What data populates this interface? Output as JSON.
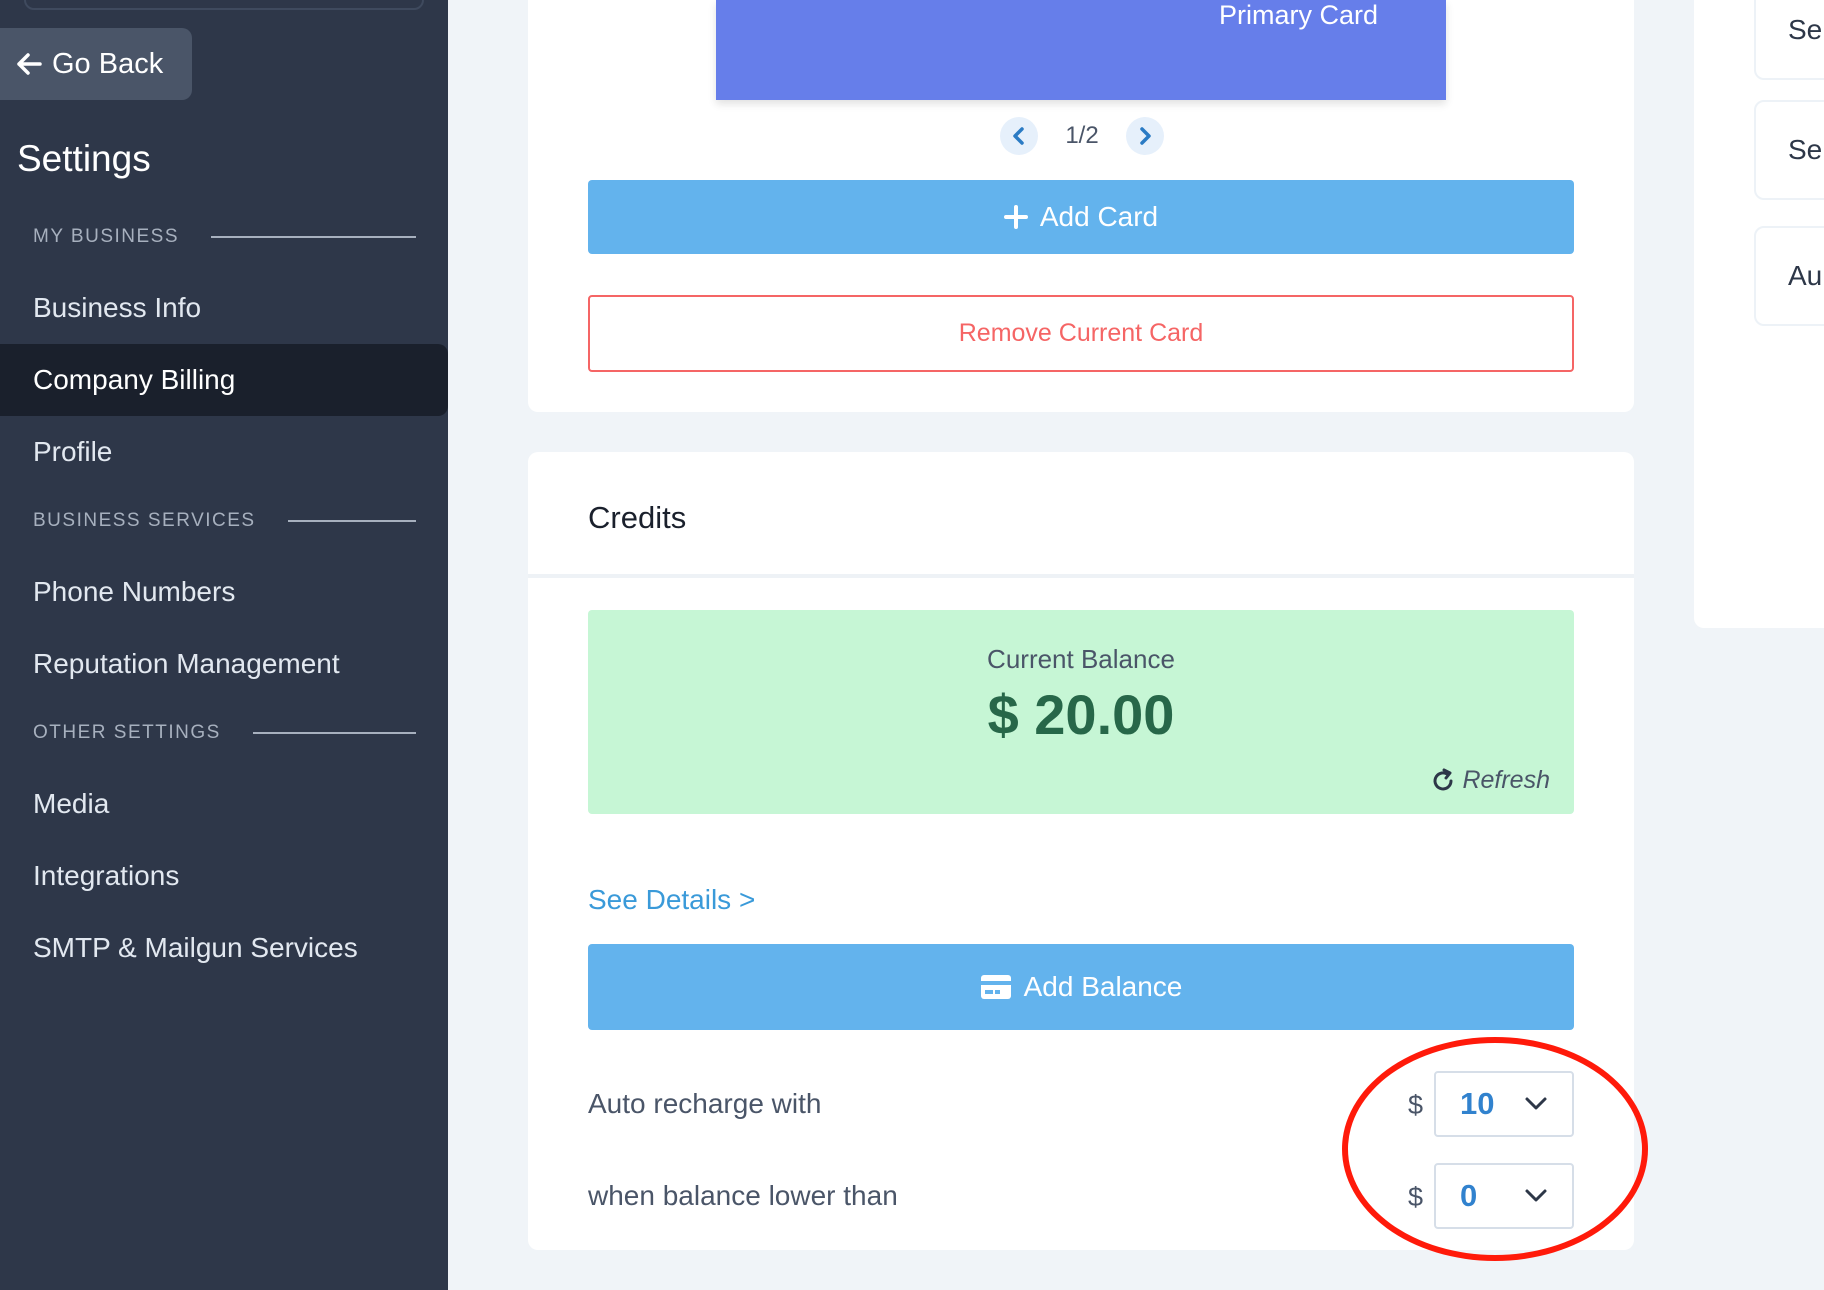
{
  "sidebar": {
    "go_back": "Go Back",
    "title": "Settings",
    "sections": {
      "my_business": "MY BUSINESS",
      "business_services": "BUSINESS SERVICES",
      "other_settings": "OTHER SETTINGS"
    },
    "items": {
      "business_info": "Business Info",
      "company_billing": "Company Billing",
      "profile": "Profile",
      "phone_numbers": "Phone Numbers",
      "reputation_management": "Reputation Management",
      "media": "Media",
      "integrations": "Integrations",
      "smtp": "SMTP & Mailgun Services"
    },
    "active_item": "Company Billing"
  },
  "card_section": {
    "primary_card_label": "Primary Card",
    "pager_text": "1/2",
    "add_card_label": "Add Card",
    "remove_card_label": "Remove Current Card"
  },
  "credits": {
    "title": "Credits",
    "balance_label": "Current Balance",
    "balance_amount": "$ 20.00",
    "refresh_label": "Refresh",
    "see_details": "See Details >",
    "add_balance_label": "Add Balance",
    "auto_recharge_label": "Auto recharge with",
    "threshold_label": "when balance lower than",
    "currency_symbol": "$",
    "auto_recharge_value": "10",
    "threshold_value": "0"
  },
  "right_column": {
    "items": [
      "Sep",
      "Sep",
      "Au"
    ]
  },
  "colors": {
    "sidebar_bg": "#2e3749",
    "active_item_bg": "#1a202c",
    "primary_card": "#667eea",
    "button_blue": "#63b3ed",
    "danger": "#f56565",
    "balance_bg": "#c6f6d5",
    "balance_text": "#276749",
    "link": "#3a9ad9",
    "annotation": "#ff1a0a"
  }
}
